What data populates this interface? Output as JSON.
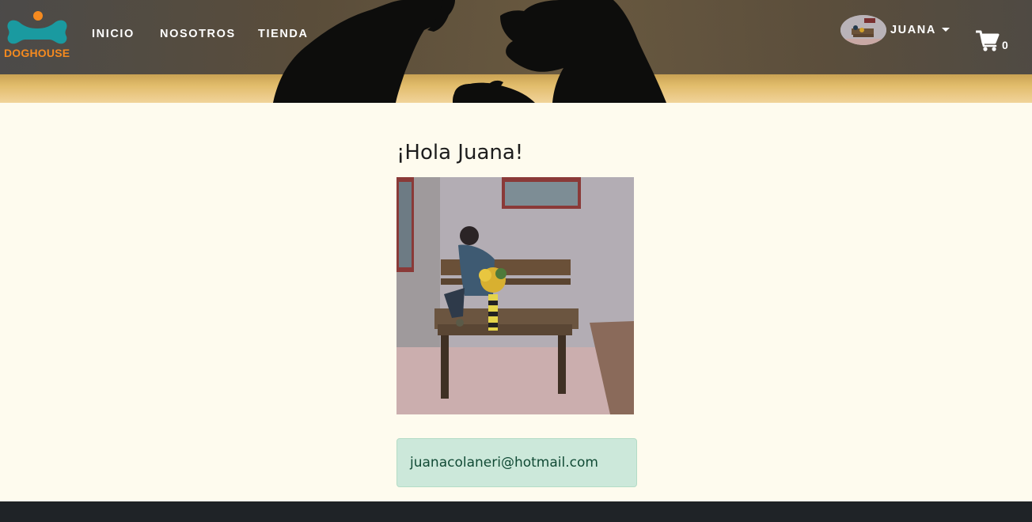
{
  "brand": {
    "name": "DOGHOUSE",
    "primary_color": "#1a9aa0",
    "accent_color": "#f58a1f",
    "icon": "bone-icon"
  },
  "nav": {
    "items": [
      {
        "label": "INICIO"
      },
      {
        "label": "NOSOTROS"
      },
      {
        "label": "TIENDA"
      }
    ]
  },
  "user": {
    "name": "JUANA",
    "menu_icon": "chevron-down-icon"
  },
  "cart": {
    "count": "0",
    "icon": "cart-icon"
  },
  "profile": {
    "greeting": "¡Hola Juana!",
    "email": "juanacolaneri@hotmail.com"
  },
  "colors": {
    "page_background": "#fefbee",
    "email_box_background": "#cce8da",
    "email_text": "#114a35",
    "footer": "#1f2327"
  }
}
